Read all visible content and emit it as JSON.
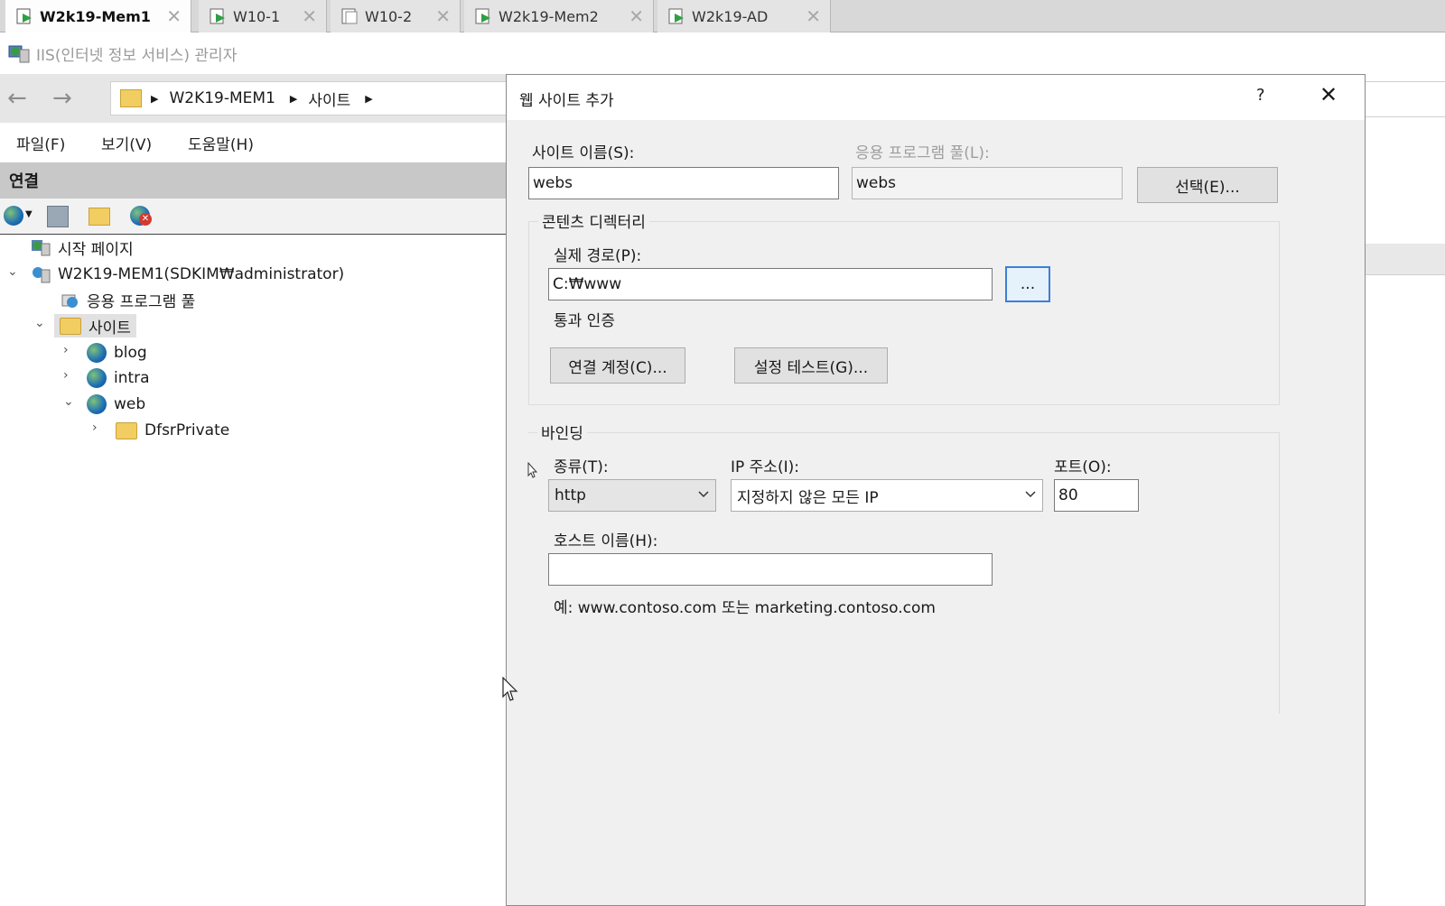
{
  "tabs": [
    {
      "label": "W2k19-Mem1",
      "active": true
    },
    {
      "label": "W10-1",
      "active": false
    },
    {
      "label": "W10-2",
      "active": false
    },
    {
      "label": "W2k19-Mem2",
      "active": false
    },
    {
      "label": "W2k19-AD",
      "active": false
    }
  ],
  "app": {
    "title": "IIS(인터넷 정보 서비스) 관리자"
  },
  "nav": {
    "breadcrumb": [
      "W2K19-MEM1",
      "사이트"
    ]
  },
  "menu": [
    "파일(F)",
    "보기(V)",
    "도움말(H)"
  ],
  "connections": {
    "header": "연결",
    "tree": {
      "start_page": "시작 페이지",
      "server": "W2K19-MEM1(SDKIM₩administrator)",
      "app_pools": "응용 프로그램 풀",
      "sites": "사이트",
      "site_items": [
        "blog",
        "intra",
        "web"
      ],
      "web_children": [
        "DfsrPrivate"
      ]
    }
  },
  "dialog": {
    "title": "웹 사이트 추가",
    "help": "?",
    "site_name_label": "사이트 이름(S):",
    "site_name_value": "webs",
    "app_pool_label": "응용 프로그램 풀(L):",
    "app_pool_value": "webs",
    "select_button": "선택(E)...",
    "content_dir_group": "콘텐츠 디렉터리",
    "physical_path_label": "실제 경로(P):",
    "physical_path_value": "C:₩www",
    "browse_button": "...",
    "passthrough_label": "통과 인증",
    "connect_as_button": "연결 계정(C)...",
    "test_settings_button": "설정 테스트(G)...",
    "binding_group": "바인딩",
    "type_label": "종류(T):",
    "type_value": "http",
    "ip_label": "IP 주소(I):",
    "ip_value": "지정하지 않은 모든 IP",
    "port_label": "포트(O):",
    "port_value": "80",
    "host_label": "호스트 이름(H):",
    "host_value": "",
    "example_text": "예: www.contoso.com 또는 marketing.contoso.com"
  }
}
